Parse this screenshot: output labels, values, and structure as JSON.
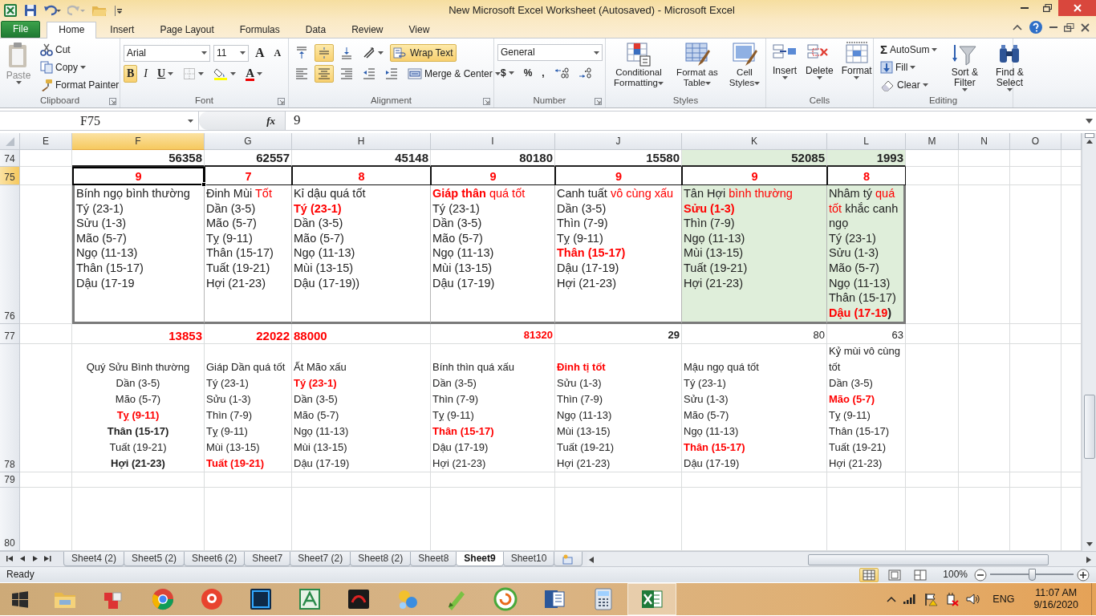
{
  "window": {
    "title": "New Microsoft Excel Worksheet (Autosaved)  -  Microsoft Excel"
  },
  "ribbon_tabs": [
    {
      "label": "File",
      "kind": "file",
      "selected": false
    },
    {
      "label": "Home",
      "kind": "tab",
      "selected": true
    },
    {
      "label": "Insert",
      "kind": "tab",
      "selected": false
    },
    {
      "label": "Page Layout",
      "kind": "tab",
      "selected": false
    },
    {
      "label": "Formulas",
      "kind": "tab",
      "selected": false
    },
    {
      "label": "Data",
      "kind": "tab",
      "selected": false
    },
    {
      "label": "Review",
      "kind": "tab",
      "selected": false
    },
    {
      "label": "View",
      "kind": "tab",
      "selected": false
    }
  ],
  "ribbon": {
    "clipboard": {
      "title": "Clipboard",
      "paste": {
        "label": "Paste",
        "disabled": true
      },
      "cut": "Cut",
      "copy": "Copy",
      "format_painter": "Format Painter"
    },
    "font": {
      "title": "Font",
      "font_name": "Arial",
      "font_size": "11",
      "grow": "A",
      "shrink": "A",
      "bold": {
        "label": "B",
        "selected": true
      },
      "italic": {
        "label": "I",
        "selected": false
      },
      "underline": {
        "label": "U",
        "selected": false
      },
      "font_color": "A"
    },
    "alignment": {
      "title": "Alignment",
      "vertical": [
        {
          "selected": false
        },
        {
          "selected": true
        },
        {
          "selected": false
        }
      ],
      "horizontal": [
        {
          "selected": false
        },
        {
          "selected": true
        },
        {
          "selected": false
        }
      ],
      "wrap_text": {
        "label": "Wrap Text",
        "selected": true
      },
      "merge_center": "Merge & Center"
    },
    "number": {
      "title": "Number",
      "format": "General",
      "currency": "$",
      "percent": "%",
      "comma": ","
    },
    "styles": {
      "title": "Styles",
      "buttons": [
        "Conditional Formatting",
        "Format as Table",
        "Cell Styles"
      ]
    },
    "cells": {
      "title": "Cells",
      "buttons": [
        "Insert",
        "Delete",
        "Format"
      ]
    },
    "editing": {
      "title": "Editing",
      "sum_symbol": "Σ",
      "autosum": "AutoSum",
      "fill": "Fill",
      "clear": "Clear",
      "sort_filter": "Sort & Filter",
      "find_select": "Find & Select"
    }
  },
  "formula_bar": {
    "name_box": "F75",
    "fx": "fx",
    "value": "9"
  },
  "sheet": {
    "columns": [
      {
        "label": "E",
        "selected": false
      },
      {
        "label": "F",
        "selected": true
      },
      {
        "label": "G",
        "selected": false
      },
      {
        "label": "H",
        "selected": false
      },
      {
        "label": "I",
        "selected": false
      },
      {
        "label": "J",
        "selected": false
      },
      {
        "label": "K",
        "selected": false
      },
      {
        "label": "L",
        "selected": false
      },
      {
        "label": "M",
        "selected": false
      },
      {
        "label": "N",
        "selected": false
      },
      {
        "label": "O",
        "selected": false
      }
    ],
    "rows": [
      {
        "number": "74",
        "kind": "total",
        "selected": false,
        "cells": [
          {
            "kind": "total",
            "shaded": false,
            "selected": false,
            "lines": [
              [
                {
                  "text": "56358",
                  "kind": "bold"
                }
              ]
            ]
          },
          {
            "kind": "total",
            "shaded": false,
            "selected": false,
            "lines": [
              [
                {
                  "text": "62557",
                  "kind": "bold"
                }
              ]
            ]
          },
          {
            "kind": "total",
            "shaded": false,
            "selected": false,
            "lines": [
              [
                {
                  "text": "45148",
                  "kind": "bold"
                }
              ]
            ]
          },
          {
            "kind": "total",
            "shaded": false,
            "selected": false,
            "lines": [
              [
                {
                  "text": "80180",
                  "kind": "bold"
                }
              ]
            ]
          },
          {
            "kind": "total",
            "shaded": false,
            "selected": false,
            "lines": [
              [
                {
                  "text": "15580",
                  "kind": "bold"
                }
              ]
            ]
          },
          {
            "kind": "total",
            "shaded": true,
            "selected": false,
            "lines": [
              [
                {
                  "text": "52085",
                  "kind": "bold"
                }
              ]
            ]
          },
          {
            "kind": "total",
            "shaded": true,
            "selected": false,
            "lines": [
              [
                {
                  "text": "1993",
                  "kind": "bold"
                }
              ]
            ]
          }
        ]
      },
      {
        "number": "75",
        "kind": "score",
        "selected": true,
        "cells": [
          {
            "kind": "score",
            "shaded": false,
            "selected": true,
            "lines": [
              [
                {
                  "text": "9",
                  "kind": "red-bold"
                }
              ]
            ]
          },
          {
            "kind": "score",
            "shaded": false,
            "selected": false,
            "lines": [
              [
                {
                  "text": "7",
                  "kind": "red-bold"
                }
              ]
            ]
          },
          {
            "kind": "score",
            "shaded": false,
            "selected": false,
            "lines": [
              [
                {
                  "text": "8",
                  "kind": "red-bold"
                }
              ]
            ]
          },
          {
            "kind": "score",
            "shaded": false,
            "selected": false,
            "lines": [
              [
                {
                  "text": "9",
                  "kind": "red-bold"
                }
              ]
            ]
          },
          {
            "kind": "score",
            "shaded": false,
            "selected": false,
            "lines": [
              [
                {
                  "text": "9",
                  "kind": "red-bold"
                }
              ]
            ]
          },
          {
            "kind": "score",
            "shaded": false,
            "selected": false,
            "lines": [
              [
                {
                  "text": "9",
                  "kind": "red-bold"
                }
              ]
            ]
          },
          {
            "kind": "score",
            "shaded": false,
            "selected": false,
            "lines": [
              [
                {
                  "text": "8",
                  "kind": "red-bold"
                }
              ]
            ]
          }
        ]
      },
      {
        "number": "76",
        "kind": "detail",
        "selected": false,
        "cells": [
          {
            "kind": "note",
            "shaded": false,
            "selected": false,
            "lines": [
              "Bính ngọ bình thường",
              "Tý (23-1)",
              "Sửu (1-3)",
              "Mão (5-7)",
              "Ngọ (11-13)",
              "Thân (15-17)",
              "Dậu (17-19"
            ]
          },
          {
            "kind": "note",
            "shaded": false,
            "selected": false,
            "lines": [
              [
                {
                  "text": "Đinh Mùi ",
                  "kind": "plain"
                },
                {
                  "text": "Tốt",
                  "kind": "red"
                }
              ],
              "Dần (3-5)",
              "Mão (5-7)",
              "Tỵ (9-11)",
              "Thân (15-17)",
              "Tuất (19-21)",
              "Hợi (21-23)"
            ]
          },
          {
            "kind": "note",
            "shaded": false,
            "selected": false,
            "lines": [
              "Kỉ dậu quá tốt",
              [
                {
                  "text": "Tý (23-1)",
                  "kind": "red-bold"
                }
              ],
              "Dần (3-5)",
              "Mão (5-7)",
              "Ngọ (11-13)",
              "Mùi (13-15)",
              "Dậu (17-19))"
            ]
          },
          {
            "kind": "note",
            "shaded": false,
            "selected": false,
            "lines": [
              [
                {
                  "text": "Giáp thân",
                  "kind": "red-bold"
                },
                {
                  "text": " quá tốt",
                  "kind": "red"
                }
              ],
              "Tý (23-1)",
              "Dần (3-5)",
              "Mão (5-7)",
              "Ngọ (11-13)",
              "Mùi (13-15)",
              "Dậu (17-19)"
            ]
          },
          {
            "kind": "note",
            "shaded": false,
            "selected": false,
            "lines": [
              [
                {
                  "text": "Canh tuất ",
                  "kind": "plain"
                },
                {
                  "text": "vô cùng xấu",
                  "kind": "red"
                }
              ],
              "Dần (3-5)",
              "Thìn (7-9)",
              "Tỵ (9-11)",
              [
                {
                  "text": "Thân (15-17)",
                  "kind": "red-bold"
                }
              ],
              "Dậu (17-19)",
              "Hợi (21-23)"
            ]
          },
          {
            "kind": "note",
            "shaded": true,
            "selected": false,
            "lines": [
              [
                {
                  "text": "Tân Hợi ",
                  "kind": "plain"
                },
                {
                  "text": "bình thường",
                  "kind": "red"
                }
              ],
              [
                {
                  "text": "Sửu (1-3)",
                  "kind": "red-bold"
                }
              ],
              "Thìn (7-9)",
              "Ngọ (11-13)",
              "Mùi (13-15)",
              "Tuất (19-21)",
              "Hợi (21-23)"
            ]
          },
          {
            "kind": "note",
            "shaded": true,
            "selected": false,
            "lines": [
              [
                {
                  "text": "Nhâm tý ",
                  "kind": "plain"
                },
                {
                  "text": "quá tốt",
                  "kind": "red"
                },
                {
                  "text": " khắc canh ngọ",
                  "kind": "plain"
                }
              ],
              "Tý (23-1)",
              "Sửu (1-3)",
              "Mão (5-7)",
              "Ngọ (11-13)",
              "Thân (15-17)",
              [
                {
                  "text": "Dậu (17-19",
                  "kind": "red-bold"
                },
                {
                  "text": ")",
                  "kind": "bold"
                }
              ]
            ]
          }
        ]
      },
      {
        "number": "77",
        "kind": "count",
        "selected": false,
        "cells": [
          {
            "kind": "count",
            "shaded": false,
            "selected": false,
            "lines": [
              [
                {
                  "text": "13853",
                  "kind": "red-bold"
                }
              ]
            ]
          },
          {
            "kind": "count",
            "shaded": false,
            "selected": false,
            "lines": [
              [
                {
                  "text": "22022",
                  "kind": "red-bold"
                }
              ]
            ]
          },
          {
            "kind": "count-left",
            "shaded": false,
            "selected": false,
            "lines": [
              [
                {
                  "text": "88000",
                  "kind": "red-bold"
                }
              ]
            ]
          },
          {
            "kind": "tally",
            "shaded": false,
            "selected": false,
            "lines": [
              [
                {
                  "text": "81320",
                  "kind": "red-bold"
                }
              ]
            ]
          },
          {
            "kind": "tally",
            "shaded": false,
            "selected": false,
            "lines": [
              [
                {
                  "text": "29",
                  "kind": "bold"
                }
              ]
            ]
          },
          {
            "kind": "tally",
            "shaded": false,
            "selected": false,
            "lines": [
              "80"
            ]
          },
          {
            "kind": "tally",
            "shaded": false,
            "selected": false,
            "lines": [
              "63"
            ]
          }
        ]
      },
      {
        "number": "78",
        "kind": "list",
        "selected": false,
        "cells": [
          {
            "kind": "list-centered",
            "shaded": false,
            "selected": false,
            "lines": [
              "Quý Sửu Bình thường",
              "Dần (3-5)",
              "Mão (5-7)",
              [
                {
                  "text": "Tỵ (9-11)",
                  "kind": "red-bold"
                }
              ],
              [
                {
                  "text": "Thân (15-17)",
                  "kind": "bold"
                }
              ],
              "Tuất (19-21)",
              [
                {
                  "text": "Hợi (21-23)",
                  "kind": "bold"
                }
              ]
            ]
          },
          {
            "kind": "list",
            "shaded": false,
            "selected": false,
            "lines": [
              "Giáp Dần quá tốt",
              "Tý (23-1)",
              "Sửu (1-3)",
              "Thìn (7-9)",
              "Tỵ (9-11)",
              "Mùi (13-15)",
              [
                {
                  "text": "Tuất (19-21)",
                  "kind": "red-bold"
                }
              ]
            ]
          },
          {
            "kind": "list",
            "shaded": false,
            "selected": false,
            "lines": [
              "Ất Mão xấu",
              [
                {
                  "text": "Tý (23-1)",
                  "kind": "red-bold"
                }
              ],
              "Dần (3-5)",
              "Mão (5-7)",
              "Ngọ (11-13)",
              "Mùi (13-15)",
              "Dậu (17-19)"
            ]
          },
          {
            "kind": "list",
            "shaded": false,
            "selected": false,
            "lines": [
              "Bính thìn quá xấu",
              "Dần (3-5)",
              "Thìn (7-9)",
              "Tỵ (9-11)",
              [
                {
                  "text": "Thân (15-17)",
                  "kind": "red-bold"
                }
              ],
              "Dậu (17-19)",
              "Hợi (21-23)"
            ]
          },
          {
            "kind": "list",
            "shaded": false,
            "selected": false,
            "lines": [
              [
                {
                  "text": "Đinh tị tốt",
                  "kind": "red-bold"
                }
              ],
              "Sửu (1-3)",
              "Thìn (7-9)",
              "Ngọ (11-13)",
              "Mùi (13-15)",
              "Tuất (19-21)",
              "Hợi (21-23)"
            ]
          },
          {
            "kind": "list",
            "shaded": false,
            "selected": false,
            "lines": [
              "Mậu ngọ quá tốt",
              "Tý (23-1)",
              "Sửu (1-3)",
              "Mão (5-7)",
              "Ngọ (11-13)",
              [
                {
                  "text": "Thân (15-17)",
                  "kind": "red-bold"
                }
              ],
              "Dậu (17-19)"
            ]
          },
          {
            "kind": "list",
            "shaded": false,
            "selected": false,
            "lines": [
              "Kỷ mùi vô cùng tốt",
              "Dần (3-5)",
              [
                {
                  "text": "Mão (5-7)",
                  "kind": "red-bold"
                }
              ],
              "Tỵ (9-11)",
              "Thân (15-17)",
              "Tuất (19-21)",
              "Hợi (21-23)"
            ]
          }
        ]
      },
      {
        "number": "79",
        "kind": "blank",
        "selected": false
      },
      {
        "number": "80",
        "kind": "blank",
        "selected": false
      }
    ]
  },
  "sheet_tabs": [
    {
      "label": "Sheet4 (2)",
      "selected": false
    },
    {
      "label": "Sheet5 (2)",
      "selected": false
    },
    {
      "label": "Sheet6 (2)",
      "selected": false
    },
    {
      "label": "Sheet7",
      "selected": false
    },
    {
      "label": "Sheet7 (2)",
      "selected": false
    },
    {
      "label": "Sheet8 (2)",
      "selected": false
    },
    {
      "label": "Sheet8",
      "selected": false
    },
    {
      "label": "Sheet9",
      "selected": true
    },
    {
      "label": "Sheet10",
      "selected": false
    }
  ],
  "status_bar": {
    "text": "Ready",
    "zoom": {
      "label": "100%",
      "level": 0.5
    }
  },
  "taskbar": {
    "apps": [
      {
        "selected": false
      },
      {
        "selected": false
      },
      {
        "selected": false
      },
      {
        "selected": false
      },
      {
        "selected": false
      },
      {
        "selected": false
      },
      {
        "selected": false
      },
      {
        "selected": false
      },
      {
        "selected": false
      },
      {
        "selected": false
      },
      {
        "selected": false
      },
      {
        "selected": false
      },
      {
        "selected": true
      }
    ],
    "language": "ENG",
    "time": "11:07 AM",
    "date": "9/16/2020"
  }
}
